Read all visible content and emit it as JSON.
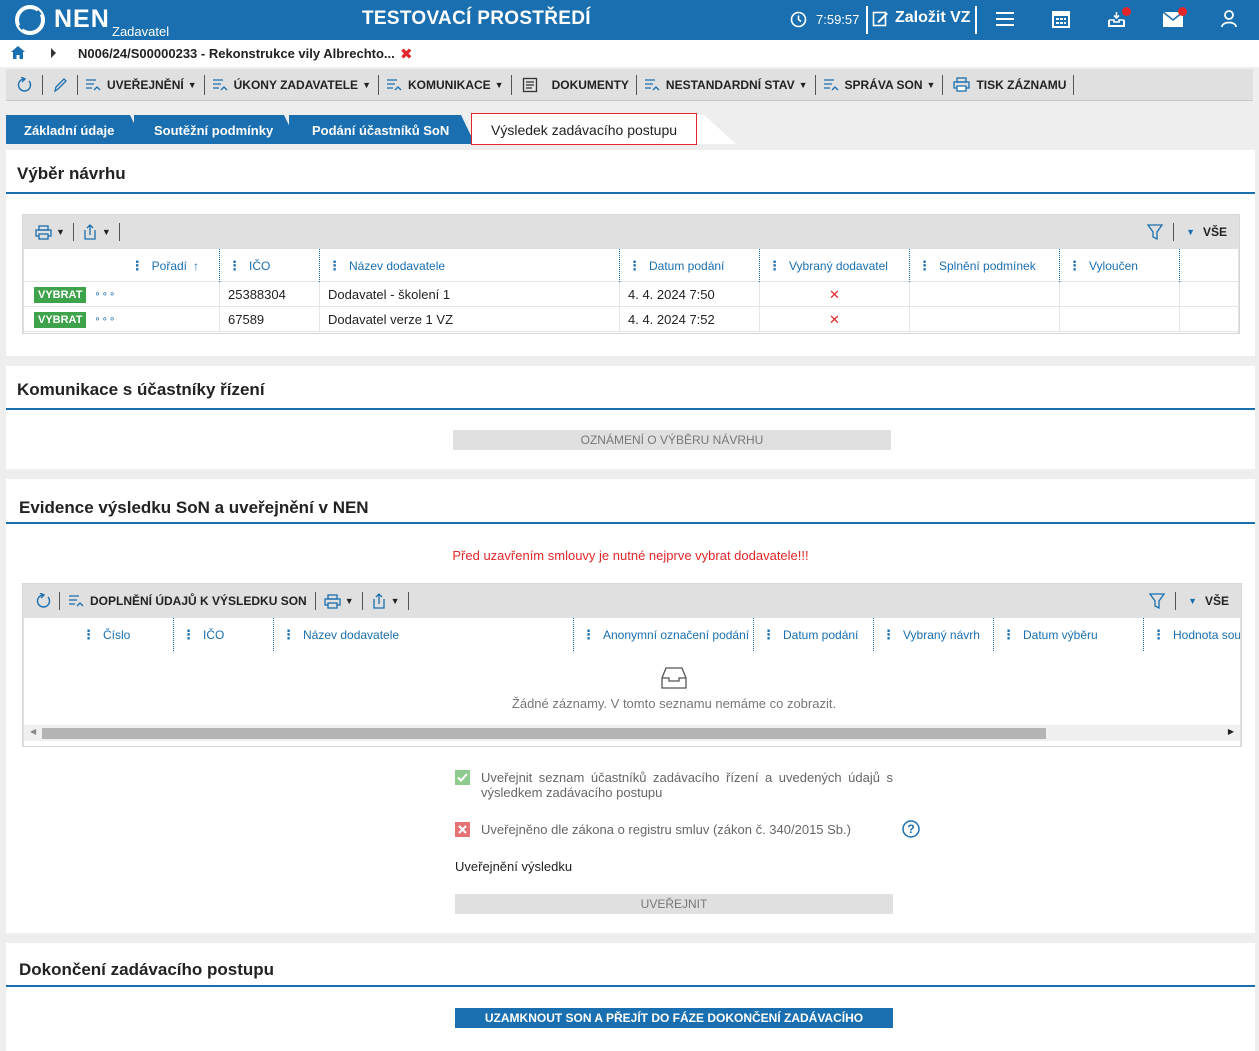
{
  "topbar": {
    "logo": "NEN",
    "logo_sub": "Zadavatel",
    "environment": "TESTOVACÍ PROSTŘEDÍ",
    "time": "7:59:57",
    "new_vz": "Založit VZ",
    "icons": [
      "clock-icon",
      "edit-icon",
      "menu-icon",
      "calendar-icon",
      "inbox-icon",
      "mail-icon",
      "user-icon"
    ],
    "accent": "#1a6fb0",
    "notify_color": "#e3262a"
  },
  "breadcrumb": {
    "text": "N006/24/S00000233 - Rekonstrukce vily Albrechto...",
    "close": "✖"
  },
  "toolbar": {
    "uverejneni": "UVEŘEJNĚNÍ",
    "ukony": "ÚKONY ZADAVATELE",
    "komunikace": "KOMUNIKACE",
    "dokumenty": "DOKUMENTY",
    "nestandardni": "NESTANDARDNÍ STAV",
    "sprava": "SPRÁVA SON",
    "tisk": "TISK ZÁZNAMU"
  },
  "tabs": [
    "Základní údaje",
    "Soutěžní podmínky",
    "Podání účastníků SoN",
    "Výsledek zadávacího postupu"
  ],
  "section1": {
    "title": "Výběr návrhu",
    "filter_all": "VŠE",
    "columns": [
      "Pořadí",
      "IČO",
      "Název dodavatele",
      "Datum podání",
      "Vybraný dodavatel",
      "Splnění podmínek",
      "Vyloučen"
    ],
    "select_label": "VYBRAT",
    "more": "∘∘∘",
    "rows": [
      {
        "ico": "25388304",
        "name": "Dodavatel - školení 1",
        "date": "4. 4. 2024 7:50",
        "selected": "✕"
      },
      {
        "ico": "67589",
        "name": "Dodavatel verze 1 VZ",
        "date": "4. 4. 2024 7:52",
        "selected": "✕"
      }
    ]
  },
  "section2": {
    "title": "Komunikace s účastníky řízení",
    "button": "OZNÁMENÍ O VÝBĚRU NÁVRHU"
  },
  "section3": {
    "title": "Evidence výsledku SoN a uveřejnění v NEN",
    "warning": "Před uzavřením smlouvy je nutné nejprve vybrat dodavatele!!!",
    "toolbar_button": "DOPLNĚNÍ ÚDAJŮ K VÝSLEDKU SON",
    "filter_all": "VŠE",
    "columns": [
      "Číslo",
      "IČO",
      "Název dodavatele",
      "Anonymní označení podání",
      "Datum podání",
      "Vybraný návrh",
      "Datum výběru",
      "Hodnota soutě"
    ],
    "empty": "Žádné záznamy. V tomto seznamu nemáme co zobrazit.",
    "check1": "Uveřejnit seznam účastníků zadávacího řízení a uvedených údajů s výsledkem zadávacího postupu",
    "check2": "Uveřejněno dle zákona o registru smluv (zákon č. 340/2015 Sb.)",
    "publish_label": "Uveřejnění výsledku",
    "publish_button": "UVEŘEJNIT"
  },
  "section4": {
    "title": "Dokončení zadávacího postupu",
    "button": "UZAMKNOUT SON A PŘEJÍT DO FÁZE DOKONČENÍ ZADÁVACÍHO POSTUPU"
  }
}
